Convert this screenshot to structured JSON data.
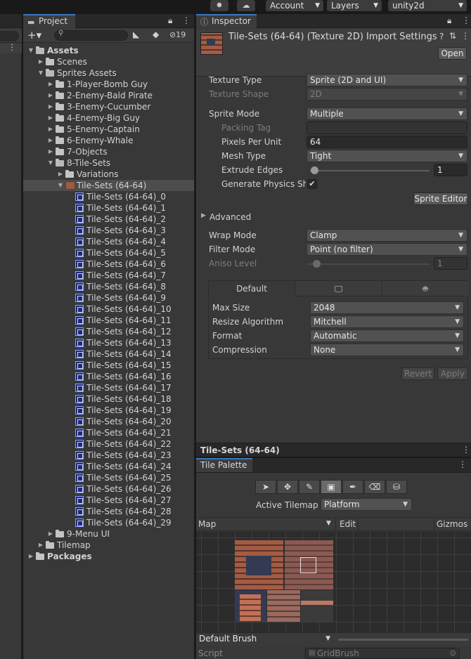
{
  "toolbar": {
    "account_label": "Account",
    "layers_label": "Layers",
    "layout_label": "unity2d"
  },
  "project": {
    "tab_label": "Project",
    "hidden_count": "19",
    "tree": [
      {
        "label": "Assets",
        "depth": 0,
        "type": "folder",
        "expanded": true,
        "bold": true
      },
      {
        "label": "Scenes",
        "depth": 1,
        "type": "folder",
        "expanded": false
      },
      {
        "label": "Sprites Assets",
        "depth": 1,
        "type": "folder",
        "expanded": true
      },
      {
        "label": "1-Player-Bomb Guy",
        "depth": 2,
        "type": "folder",
        "expanded": false
      },
      {
        "label": "2-Enemy-Bald Pirate",
        "depth": 2,
        "type": "folder",
        "expanded": false
      },
      {
        "label": "3-Enemy-Cucumber",
        "depth": 2,
        "type": "folder",
        "expanded": false
      },
      {
        "label": "4-Enemy-Big Guy",
        "depth": 2,
        "type": "folder",
        "expanded": false
      },
      {
        "label": "5-Enemy-Captain",
        "depth": 2,
        "type": "folder",
        "expanded": false
      },
      {
        "label": "6-Enemy-Whale",
        "depth": 2,
        "type": "folder",
        "expanded": false
      },
      {
        "label": "7-Objects",
        "depth": 2,
        "type": "folder",
        "expanded": false
      },
      {
        "label": "8-Tile-Sets",
        "depth": 2,
        "type": "folder",
        "expanded": true
      },
      {
        "label": "Variations",
        "depth": 3,
        "type": "folder",
        "expanded": false
      },
      {
        "label": "Tile-Sets (64-64)",
        "depth": 3,
        "type": "texture",
        "expanded": true,
        "selected": true
      },
      {
        "label": "Tile-Sets (64-64)_0",
        "depth": 4,
        "type": "sprite"
      },
      {
        "label": "Tile-Sets (64-64)_1",
        "depth": 4,
        "type": "sprite"
      },
      {
        "label": "Tile-Sets (64-64)_2",
        "depth": 4,
        "type": "sprite"
      },
      {
        "label": "Tile-Sets (64-64)_3",
        "depth": 4,
        "type": "sprite"
      },
      {
        "label": "Tile-Sets (64-64)_4",
        "depth": 4,
        "type": "sprite"
      },
      {
        "label": "Tile-Sets (64-64)_5",
        "depth": 4,
        "type": "sprite"
      },
      {
        "label": "Tile-Sets (64-64)_6",
        "depth": 4,
        "type": "sprite"
      },
      {
        "label": "Tile-Sets (64-64)_7",
        "depth": 4,
        "type": "sprite"
      },
      {
        "label": "Tile-Sets (64-64)_8",
        "depth": 4,
        "type": "sprite"
      },
      {
        "label": "Tile-Sets (64-64)_9",
        "depth": 4,
        "type": "sprite"
      },
      {
        "label": "Tile-Sets (64-64)_10",
        "depth": 4,
        "type": "sprite"
      },
      {
        "label": "Tile-Sets (64-64)_11",
        "depth": 4,
        "type": "sprite"
      },
      {
        "label": "Tile-Sets (64-64)_12",
        "depth": 4,
        "type": "sprite"
      },
      {
        "label": "Tile-Sets (64-64)_13",
        "depth": 4,
        "type": "sprite"
      },
      {
        "label": "Tile-Sets (64-64)_14",
        "depth": 4,
        "type": "sprite"
      },
      {
        "label": "Tile-Sets (64-64)_15",
        "depth": 4,
        "type": "sprite"
      },
      {
        "label": "Tile-Sets (64-64)_16",
        "depth": 4,
        "type": "sprite"
      },
      {
        "label": "Tile-Sets (64-64)_17",
        "depth": 4,
        "type": "sprite"
      },
      {
        "label": "Tile-Sets (64-64)_18",
        "depth": 4,
        "type": "sprite"
      },
      {
        "label": "Tile-Sets (64-64)_19",
        "depth": 4,
        "type": "sprite"
      },
      {
        "label": "Tile-Sets (64-64)_20",
        "depth": 4,
        "type": "sprite"
      },
      {
        "label": "Tile-Sets (64-64)_21",
        "depth": 4,
        "type": "sprite"
      },
      {
        "label": "Tile-Sets (64-64)_22",
        "depth": 4,
        "type": "sprite"
      },
      {
        "label": "Tile-Sets (64-64)_23",
        "depth": 4,
        "type": "sprite"
      },
      {
        "label": "Tile-Sets (64-64)_24",
        "depth": 4,
        "type": "sprite"
      },
      {
        "label": "Tile-Sets (64-64)_25",
        "depth": 4,
        "type": "sprite"
      },
      {
        "label": "Tile-Sets (64-64)_26",
        "depth": 4,
        "type": "sprite"
      },
      {
        "label": "Tile-Sets (64-64)_27",
        "depth": 4,
        "type": "sprite"
      },
      {
        "label": "Tile-Sets (64-64)_28",
        "depth": 4,
        "type": "sprite"
      },
      {
        "label": "Tile-Sets (64-64)_29",
        "depth": 4,
        "type": "sprite"
      },
      {
        "label": "9-Menu UI",
        "depth": 2,
        "type": "folder",
        "expanded": false
      },
      {
        "label": "Tilemap",
        "depth": 1,
        "type": "folder",
        "expanded": false
      },
      {
        "label": "Packages",
        "depth": 0,
        "type": "folder",
        "expanded": false,
        "bold": true
      }
    ]
  },
  "inspector": {
    "tab_label": "Inspector",
    "title": "Tile-Sets (64-64) (Texture 2D) Import Settings",
    "open_button": "Open",
    "texture_type_label": "Texture Type",
    "texture_type_value": "Sprite (2D and UI)",
    "texture_shape_label": "Texture Shape",
    "texture_shape_value": "2D",
    "sprite_mode_label": "Sprite Mode",
    "sprite_mode_value": "Multiple",
    "packing_tag_label": "Packing Tag",
    "packing_tag_value": "",
    "ppu_label": "Pixels Per Unit",
    "ppu_value": "64",
    "mesh_type_label": "Mesh Type",
    "mesh_type_value": "Tight",
    "extrude_label": "Extrude Edges",
    "extrude_value": "1",
    "physics_shape_label": "Generate Physics Sha",
    "physics_shape_checked": true,
    "sprite_editor_button": "Sprite Editor",
    "advanced_label": "Advanced",
    "wrap_mode_label": "Wrap Mode",
    "wrap_mode_value": "Clamp",
    "filter_mode_label": "Filter Mode",
    "filter_mode_value": "Point (no filter)",
    "aniso_label": "Aniso Level",
    "aniso_value": "1",
    "platform_tab_default": "Default",
    "max_size_label": "Max Size",
    "max_size_value": "2048",
    "resize_label": "Resize Algorithm",
    "resize_value": "Mitchell",
    "format_label": "Format",
    "format_value": "Automatic",
    "compression_label": "Compression",
    "compression_value": "None",
    "revert_button": "Revert",
    "apply_button": "Apply"
  },
  "preview": {
    "title": "Tile-Sets (64-64)"
  },
  "palette": {
    "tab_label": "Tile Palette",
    "active_tilemap_label": "Active Tilemap",
    "active_tilemap_value": "Platform",
    "map_label": "Map",
    "edit_label": "Edit",
    "gizmos_label": "Gizmos",
    "brush_label": "Default Brush",
    "script_label": "Script",
    "script_value": "GridBrush"
  },
  "colors": {
    "accent": "#3a79bb",
    "panel_bg": "#383838",
    "selection": "#4d4d4d"
  }
}
